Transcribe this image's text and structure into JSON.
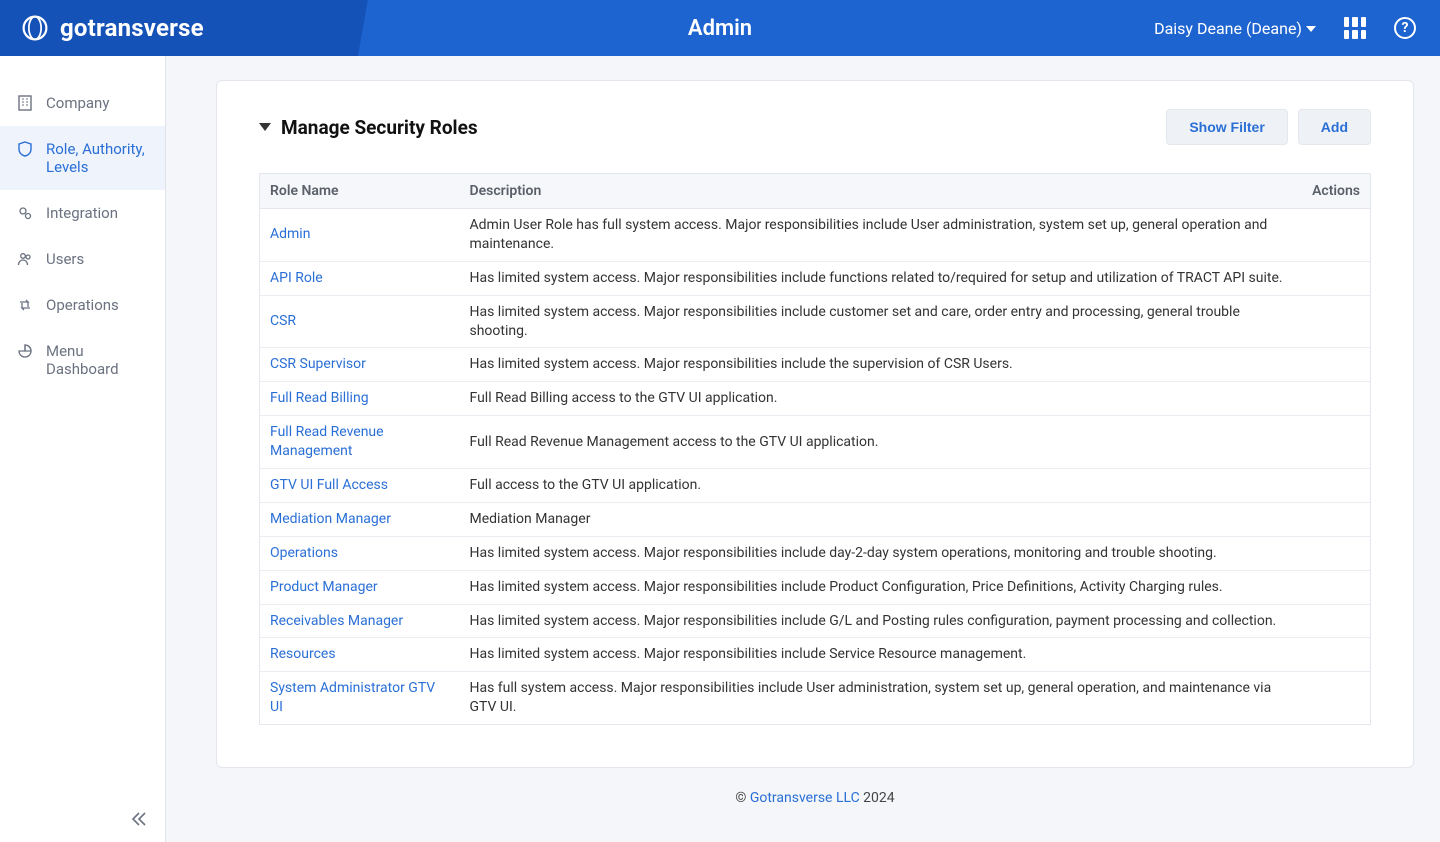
{
  "header": {
    "brand": "gotransverse",
    "title": "Admin",
    "user_label": "Daisy Deane (Deane)",
    "help_symbol": "?"
  },
  "sidebar": {
    "items": [
      {
        "label": "Company",
        "icon": "building-icon"
      },
      {
        "label": "Role, Authority, Levels",
        "icon": "shield-icon"
      },
      {
        "label": "Integration",
        "icon": "gears-icon"
      },
      {
        "label": "Users",
        "icon": "users-icon"
      },
      {
        "label": "Operations",
        "icon": "retweet-icon"
      },
      {
        "label": "Menu Dashboard",
        "icon": "pie-chart-icon"
      }
    ],
    "active_index": 1
  },
  "panel": {
    "title": "Manage Security Roles",
    "show_filter_label": "Show Filter",
    "add_label": "Add"
  },
  "table": {
    "columns": [
      "Role Name",
      "Description",
      "Actions"
    ],
    "rows": [
      {
        "name": "Admin",
        "description": "Admin User Role has full system access. Major responsibilities include User administration, system set up, general operation and maintenance."
      },
      {
        "name": "API Role",
        "description": "Has limited system access. Major responsibilities include functions related to/required for setup and utilization of TRACT API suite."
      },
      {
        "name": "CSR",
        "description": "Has limited system access. Major responsibilities include customer set and care, order entry and processing, general trouble shooting."
      },
      {
        "name": "CSR Supervisor",
        "description": "Has limited system access. Major responsibilities include the supervision of CSR Users."
      },
      {
        "name": "Full Read Billing",
        "description": "Full Read Billing access to the GTV UI application."
      },
      {
        "name": "Full Read Revenue Management",
        "description": "Full Read Revenue Management access to the GTV UI application."
      },
      {
        "name": "GTV UI Full Access",
        "description": "Full access to the GTV UI application."
      },
      {
        "name": "Mediation Manager",
        "description": "Mediation Manager"
      },
      {
        "name": "Operations",
        "description": "Has limited system access. Major responsibilities include day-2-day system operations, monitoring and trouble shooting."
      },
      {
        "name": "Product Manager",
        "description": "Has limited system access. Major responsibilities include Product Configuration, Price Definitions, Activity Charging rules."
      },
      {
        "name": "Receivables Manager",
        "description": "Has limited system access. Major responsibilities include G/L and Posting rules configuration, payment processing and collection."
      },
      {
        "name": "Resources",
        "description": "Has limited system access. Major responsibilities include Service Resource management."
      },
      {
        "name": "System Administrator GTV UI",
        "description": "Has full system access. Major responsibilities include User administration, system set up, general operation, and maintenance via GTV UI."
      }
    ]
  },
  "footer": {
    "copyright_symbol": "©",
    "link_text": "Gotransverse LLC",
    "year": "2024"
  }
}
